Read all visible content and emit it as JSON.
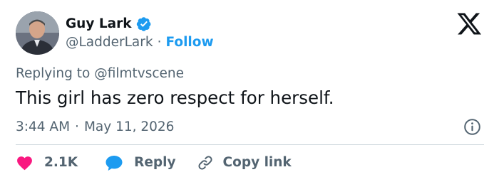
{
  "author": {
    "display_name": "Guy Lark",
    "handle": "@LadderLark",
    "separator": "·",
    "follow_label": "Follow",
    "verified_icon": "verified-badge-icon",
    "avatar_icon": "avatar-photo"
  },
  "tweet": {
    "replying_prefix": "Replying to",
    "replying_to": "@filmtvscene",
    "text": "This girl has zero respect for herself.",
    "time": "3:44 AM",
    "date": "May 11, 2026"
  },
  "actions": {
    "like_count": "2.1K",
    "reply_label": "Reply",
    "copy_label": "Copy link"
  },
  "icons": {
    "brand": "x-logo-icon",
    "info": "info-icon",
    "like": "heart-icon",
    "reply": "speech-bubble-icon",
    "copy": "link-icon"
  },
  "colors": {
    "accent": "#1d9bf0",
    "heart": "#f91880",
    "text": "#0f1419",
    "muted": "#536471",
    "divider": "#cfd9de"
  }
}
